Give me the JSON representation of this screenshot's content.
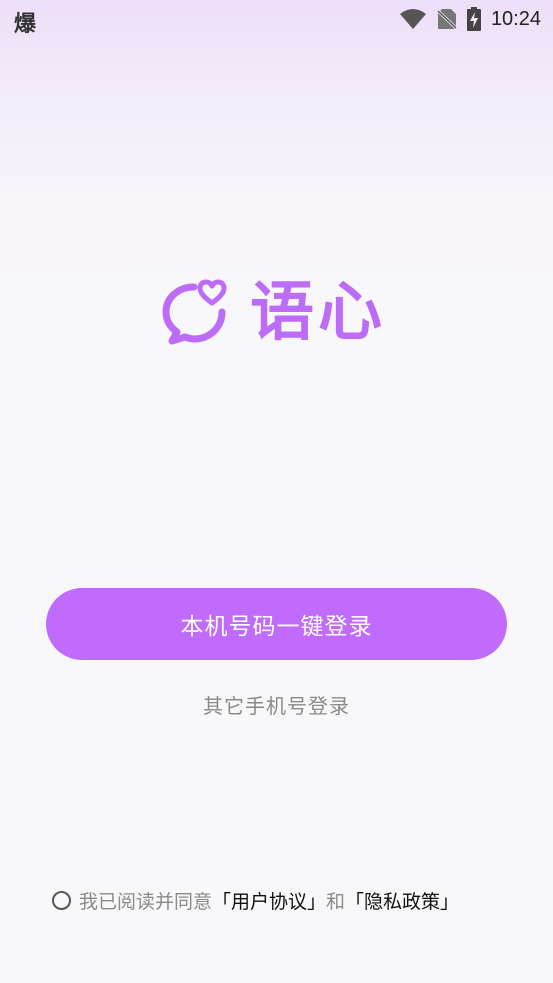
{
  "status_bar": {
    "left_glyph": "爆",
    "time": "10:24",
    "icons": [
      "wifi-icon",
      "no-sim-icon",
      "battery-charging-icon"
    ]
  },
  "logo": {
    "icon": "chat-heart-icon",
    "text": "语心"
  },
  "login": {
    "one_click_label": "本机号码一键登录",
    "other_phone_label": "其它手机号登录"
  },
  "agreement": {
    "prefix": "我已阅读并同意",
    "user_agreement": "「用户协议」",
    "conjunction": "和",
    "privacy_policy": "「隐私政策」",
    "checked": false
  },
  "colors": {
    "accent": "#c06bfb",
    "logo": "#bc6cf6",
    "secondary_text": "#8a8a8a"
  }
}
